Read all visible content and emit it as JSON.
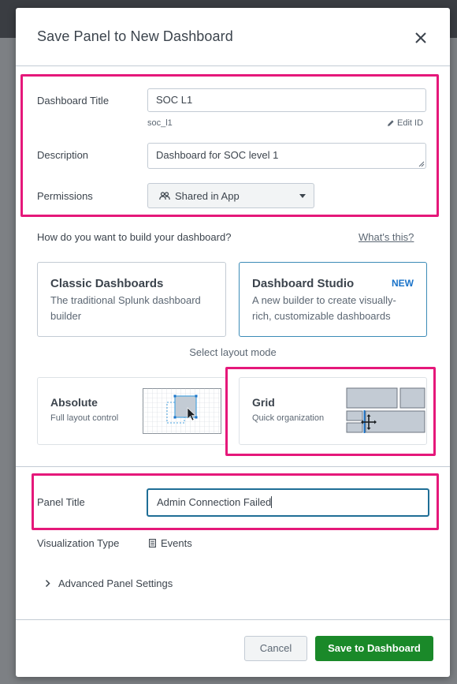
{
  "dialog": {
    "title": "Save Panel to New Dashboard"
  },
  "form": {
    "dashboard_title_label": "Dashboard Title",
    "dashboard_title_value": "SOC L1",
    "dashboard_id": "soc_l1",
    "edit_id_label": "Edit ID",
    "description_label": "Description",
    "description_value": "Dashboard for SOC level 1",
    "permissions_label": "Permissions",
    "permissions_value": "Shared in App"
  },
  "builder": {
    "question": "How do you want to build your dashboard?",
    "whats_this": "What's this?",
    "options": [
      {
        "title": "Classic Dashboards",
        "description": "The traditional Splunk dashboard builder",
        "badge": ""
      },
      {
        "title": "Dashboard Studio",
        "description": "A new builder to create visually-rich, customizable dashboards",
        "badge": "NEW"
      }
    ],
    "selected": "Dashboard Studio"
  },
  "layout": {
    "label": "Select layout mode",
    "modes": [
      {
        "title": "Absolute",
        "subtitle": "Full layout control"
      },
      {
        "title": "Grid",
        "subtitle": "Quick organization"
      }
    ]
  },
  "panel": {
    "title_label": "Panel Title",
    "title_value": "Admin Connection Failed",
    "viz_type_label": "Visualization Type",
    "viz_type_value": "Events",
    "advanced_label": "Advanced Panel Settings"
  },
  "footer": {
    "cancel_label": "Cancel",
    "save_label": "Save to Dashboard"
  },
  "colors": {
    "highlight": "#e5187a",
    "primary_button": "#1a8929",
    "selected_card_border": "#3c8bb7",
    "new_badge": "#1a73c9"
  }
}
